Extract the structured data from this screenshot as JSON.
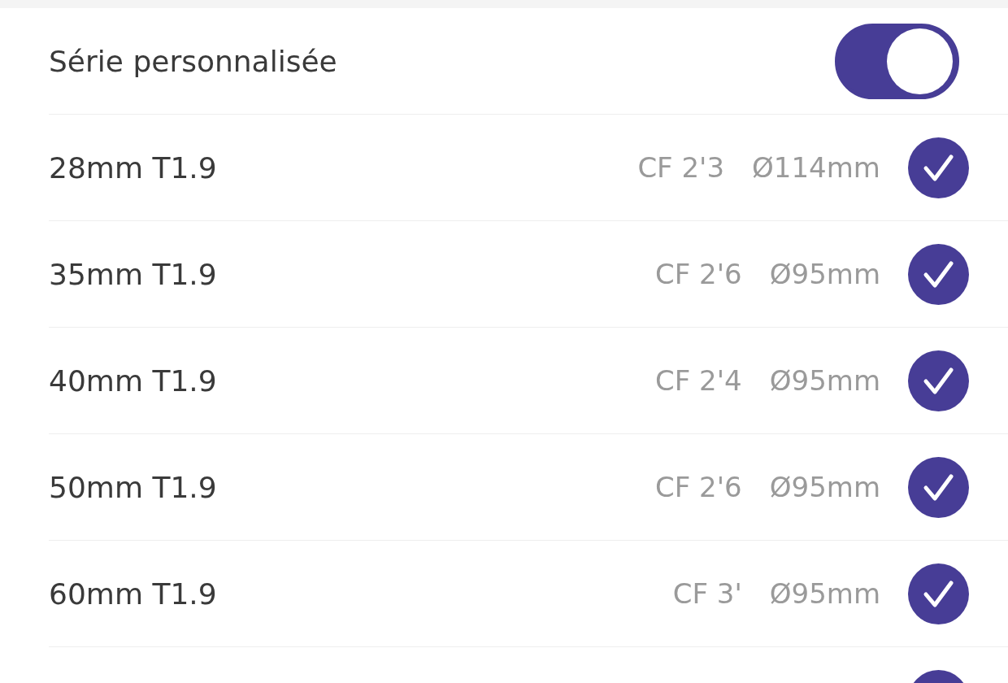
{
  "custom_series": {
    "label": "Série personnalisée",
    "on": true
  },
  "lenses": [
    {
      "name": "28mm T1.9",
      "close_focus": "CF 2'3",
      "diameter": "Ø114mm",
      "checked": true
    },
    {
      "name": "35mm T1.9",
      "close_focus": "CF 2'6",
      "diameter": "Ø95mm",
      "checked": true
    },
    {
      "name": "40mm T1.9",
      "close_focus": "CF 2'4",
      "diameter": "Ø95mm",
      "checked": true
    },
    {
      "name": "50mm T1.9",
      "close_focus": "CF 2'6",
      "diameter": "Ø95mm",
      "checked": true
    },
    {
      "name": "60mm T1.9",
      "close_focus": "CF 3'",
      "diameter": "Ø95mm",
      "checked": true
    },
    {
      "checked": true
    }
  ]
}
